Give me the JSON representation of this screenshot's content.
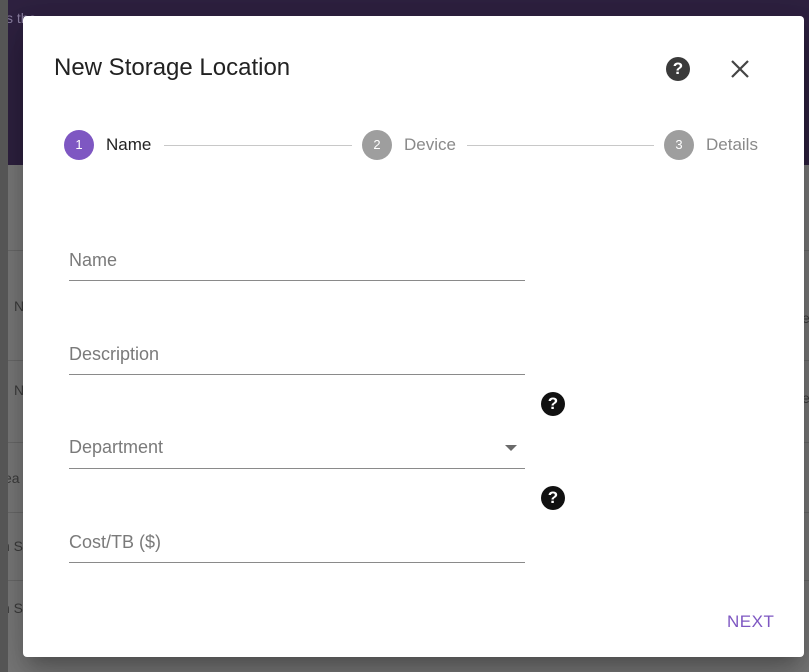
{
  "background": {
    "header_fragment": "s the                  ",
    "row_fragments": [
      "N",
      "N",
      "ea",
      "n S",
      "n S"
    ],
    "right_fragments": [
      "e",
      "e"
    ]
  },
  "dialog": {
    "title": "New Storage Location",
    "help_icon": "?",
    "close_icon": "close-icon"
  },
  "stepper": {
    "steps": [
      {
        "number": "1",
        "label": "Name",
        "state": "active"
      },
      {
        "number": "2",
        "label": "Device",
        "state": "inactive"
      },
      {
        "number": "3",
        "label": "Details",
        "state": "inactive"
      }
    ]
  },
  "form": {
    "name": {
      "placeholder": "Name",
      "value": ""
    },
    "description": {
      "placeholder": "Description",
      "value": ""
    },
    "department": {
      "label": "Department",
      "value": ""
    },
    "cost": {
      "placeholder": "Cost/TB ($)",
      "value": ""
    },
    "help_glyph": "?"
  },
  "actions": {
    "next_label": "NEXT"
  },
  "colors": {
    "accent": "#7e57c2",
    "inactive_step": "#9e9e9e"
  }
}
